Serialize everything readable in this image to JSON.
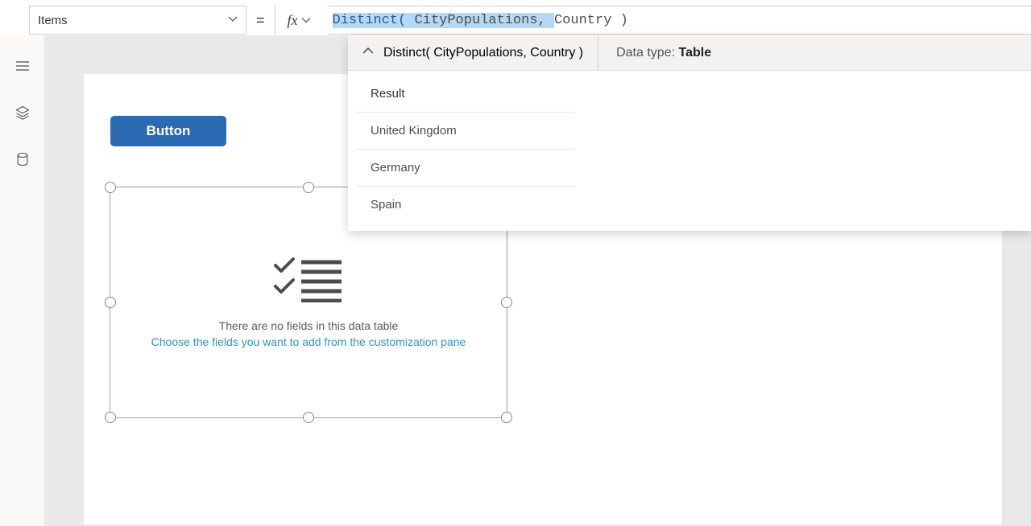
{
  "property_selector": {
    "value": "Items"
  },
  "equals_symbol": "=",
  "formula": {
    "segments": [
      {
        "text": "Distinct( ",
        "cls": "tok-fn",
        "sel": true
      },
      {
        "text": "CityPopulations",
        "cls": "tok-id",
        "sel": true
      },
      {
        "text": ", ",
        "cls": "tok-op",
        "sel": true
      },
      {
        "text": "Country ",
        "cls": "tok-id",
        "sel": false
      },
      {
        "text": ")",
        "cls": "tok-op",
        "sel": false
      }
    ]
  },
  "intellisense": {
    "header_expr": "Distinct( CityPopulations, Country )",
    "datatype_label": "Data type:",
    "datatype_value": "Table",
    "result_header": "Result",
    "rows": [
      "United Kingdom",
      "Germany",
      "Spain"
    ]
  },
  "canvas": {
    "button_label": "Button",
    "placeholder_line1": "There are no fields in this data table",
    "placeholder_line2": "Choose the fields you want to add from the customization pane"
  }
}
